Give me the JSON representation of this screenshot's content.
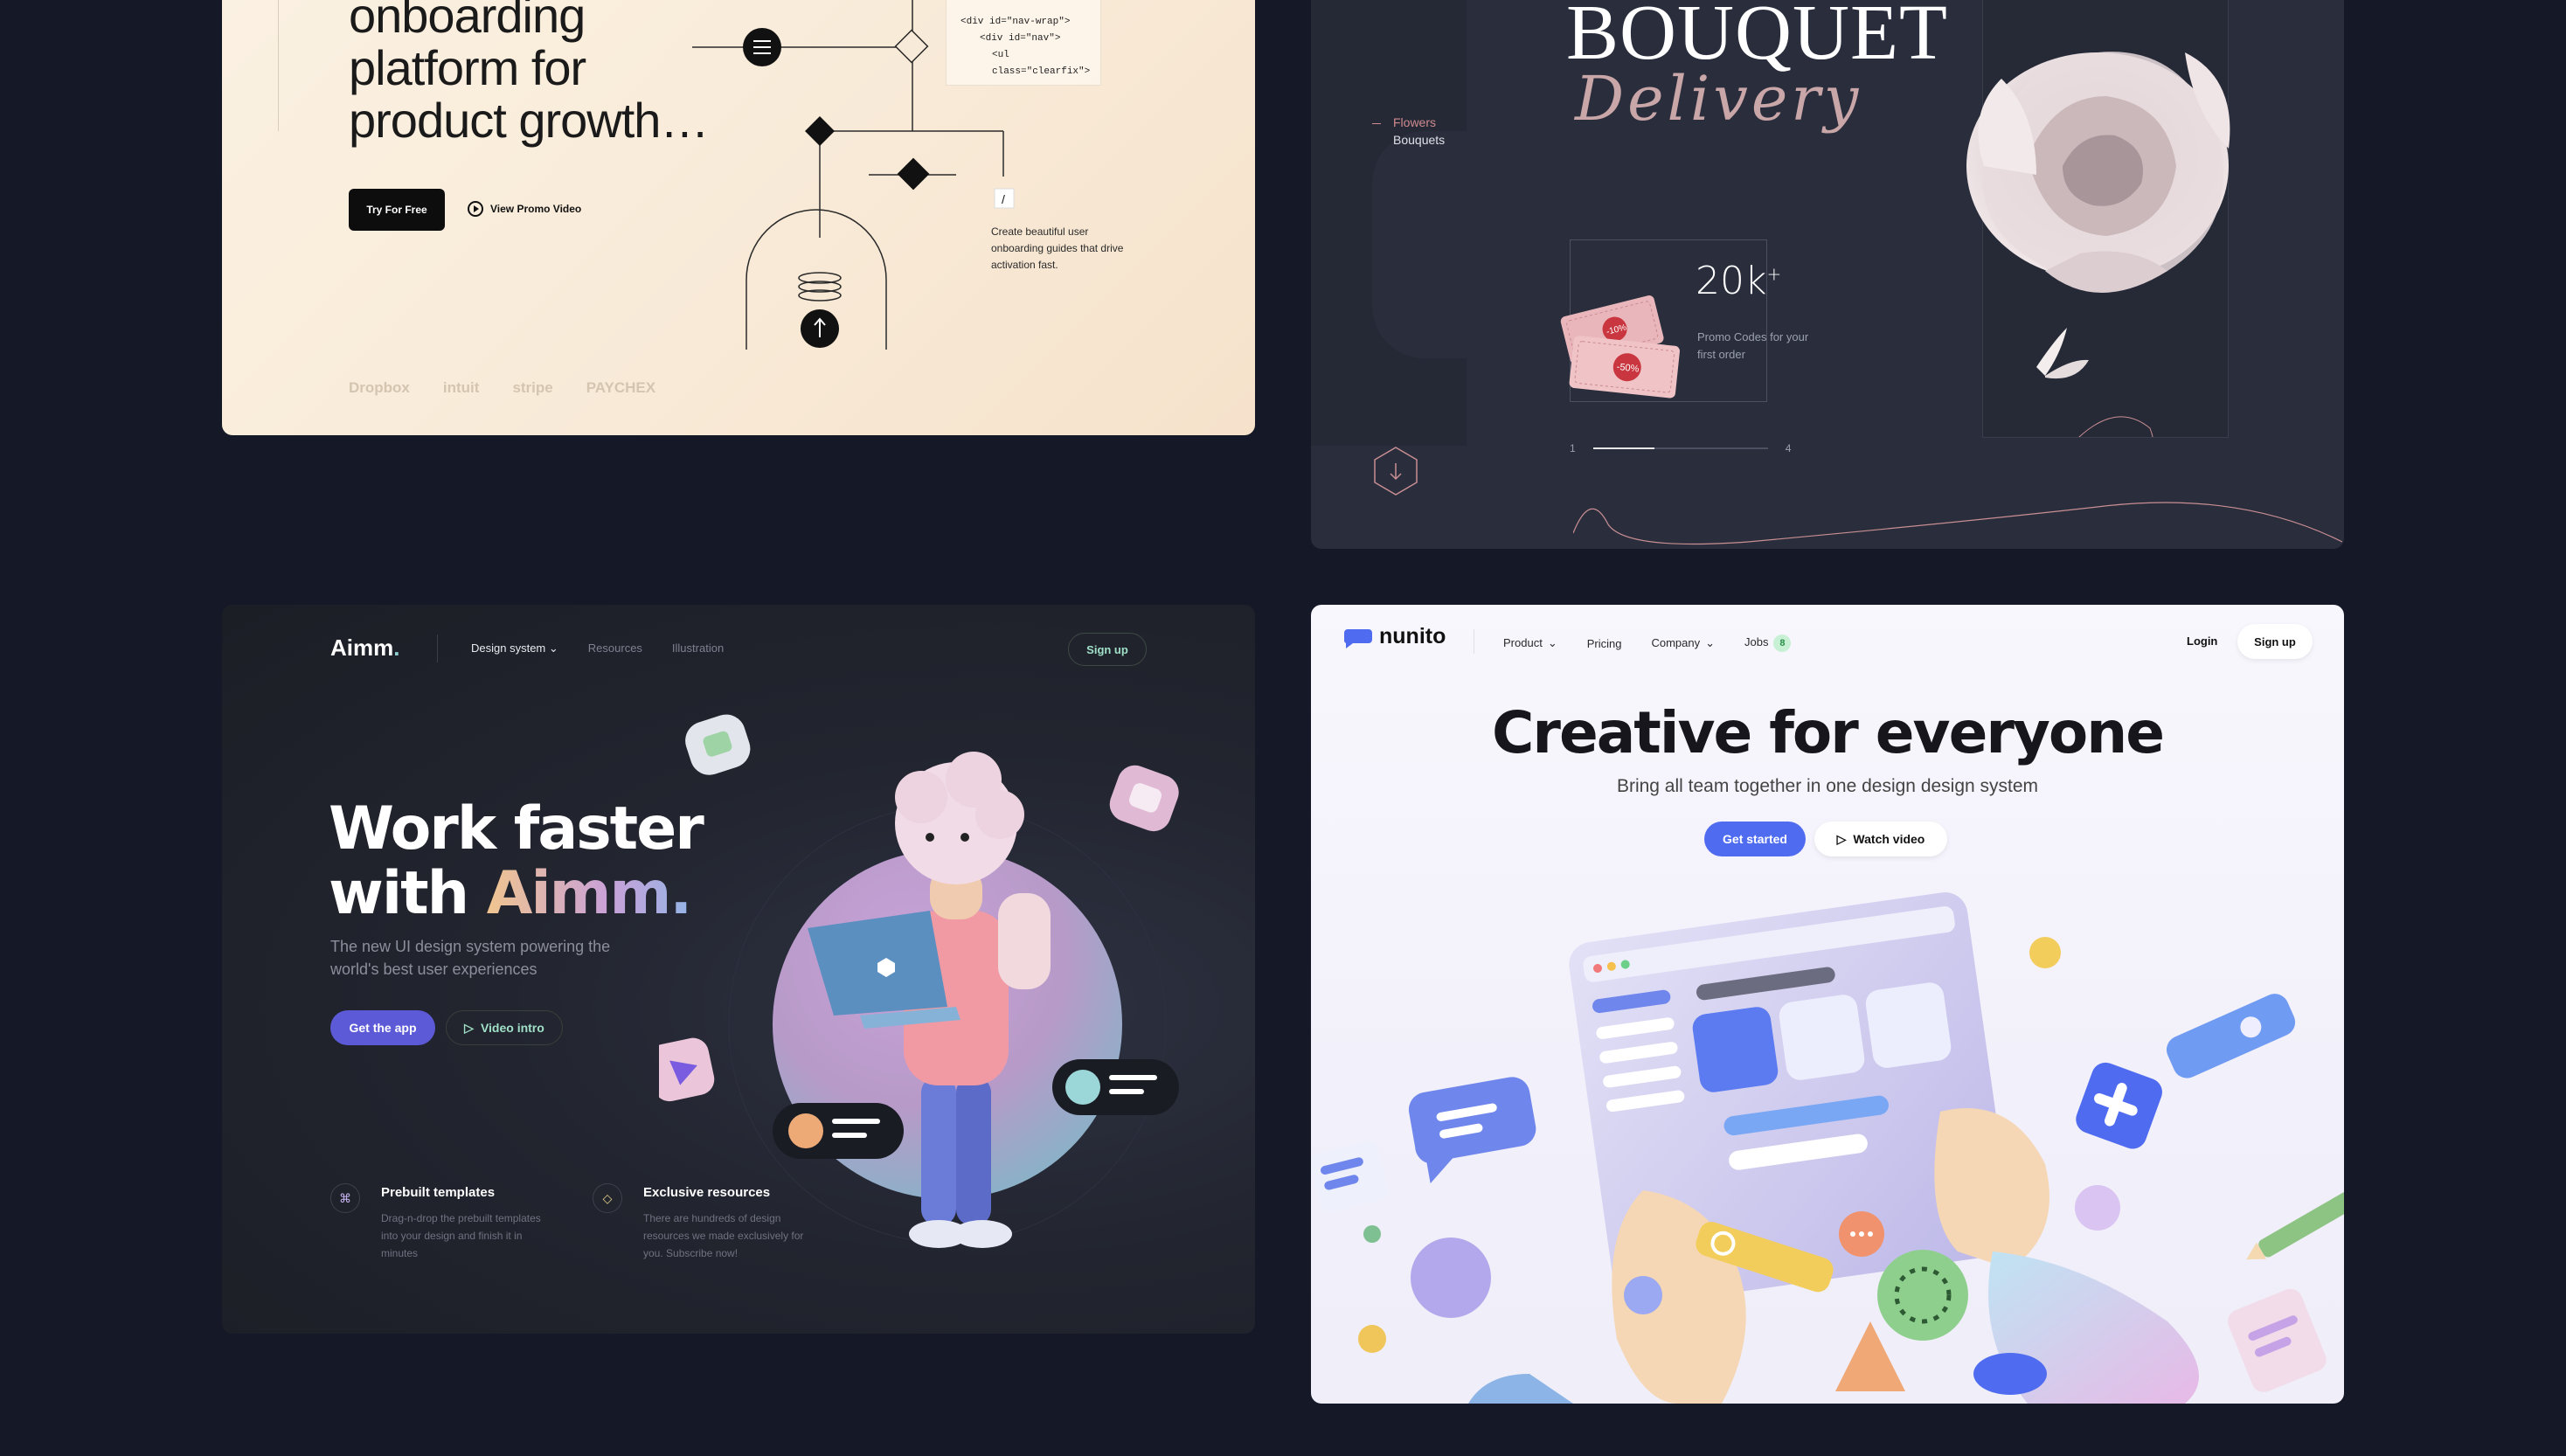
{
  "card_onboarding": {
    "hero_lines": [
      "onboarding",
      "platform for",
      "product growth…"
    ],
    "try_button": "Try For Free",
    "promo_video": "View Promo Video",
    "code_lines": [
      "<div id=\"nav-wrap\">",
      "<div id=\"nav\">",
      "<ul class=\"clearfix\">"
    ],
    "description": "Create beautiful user onboarding guides that drive activation fast.",
    "logos": [
      "Dropbox",
      "intuit",
      "stripe",
      "PAYCHEX"
    ],
    "accent": "#0d0d0d"
  },
  "card_bouquet": {
    "title": "BOUQUET",
    "script_title": "Delivery",
    "nav_items": [
      "Flowers",
      "Bouquets"
    ],
    "promo_value": "20k",
    "promo_plus": "+",
    "promo_text": "Promo Codes for your first order",
    "ticket_labels": [
      "-10%",
      "-50%"
    ],
    "slider_start": "1",
    "slider_end": "4",
    "slider_progress": 0.35,
    "accent": "#d08a8f"
  },
  "card_aimm": {
    "logo": "Aimm",
    "logo_dot": ".",
    "nav_items": [
      "Design system",
      "Resources",
      "Illustration"
    ],
    "signup": "Sign up",
    "headline_1": "Work faster",
    "headline_2a": "with ",
    "headline_2b": "Aimm.",
    "subtext": "The new UI design system powering the world's best user experiences",
    "get_app": "Get the app",
    "video_intro": "Video intro",
    "features": [
      {
        "title": "Prebuilt templates",
        "desc": "Drag-n-drop the prebuilt templates into your design and finish it in minutes",
        "icon": "command-icon"
      },
      {
        "title": "Exclusive resources",
        "desc": "There are hundreds of design resources we made exclusively for you. Subscribe now!",
        "icon": "diamond-icon"
      }
    ],
    "accent": "#5d5ad7"
  },
  "card_nunito": {
    "logo": "nunito",
    "nav_items": [
      "Product",
      "Pricing",
      "Company",
      "Jobs"
    ],
    "jobs_count": "8",
    "login": "Login",
    "signup": "Sign up",
    "headline": "Creative for everyone",
    "subtext": "Bring all team together in one design design system",
    "get_started": "Get started",
    "watch_video": "Watch video",
    "accent": "#4f6cf0"
  }
}
